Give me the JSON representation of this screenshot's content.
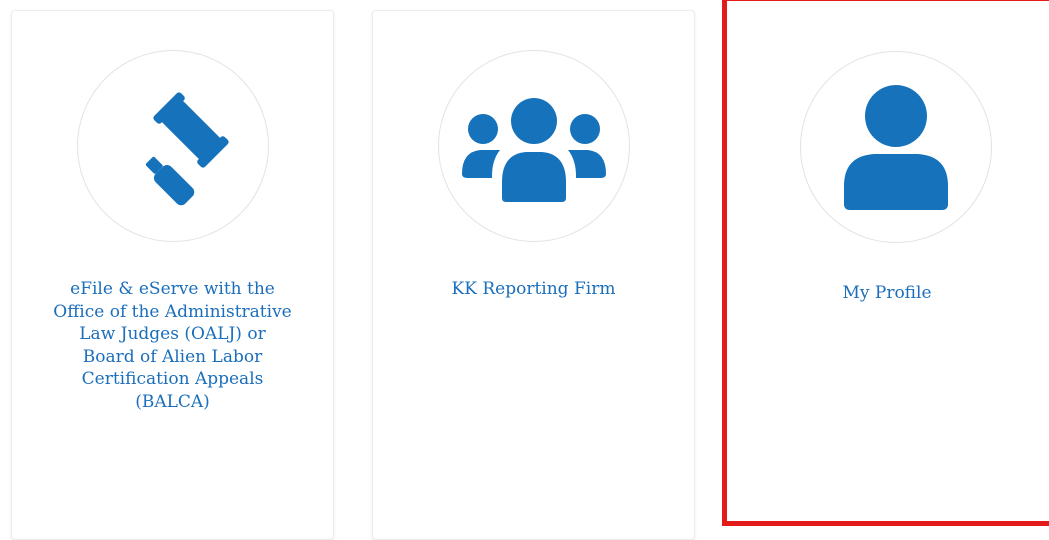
{
  "colors": {
    "icon_blue": "#1673bb",
    "label_blue": "#1a6ebb",
    "circle_border": "#e3e3e3",
    "highlight_border": "#e41b1b"
  },
  "tiles": [
    {
      "icon": "gavel-icon",
      "label": "eFile & eServe with the\nOffice of the Administrative\nLaw Judges (OALJ) or\nBoard of Alien Labor\nCertification Appeals\n(BALCA)"
    },
    {
      "icon": "users-group-icon",
      "label": "KK Reporting Firm"
    },
    {
      "icon": "user-icon",
      "label": "My Profile",
      "highlighted": true
    }
  ]
}
